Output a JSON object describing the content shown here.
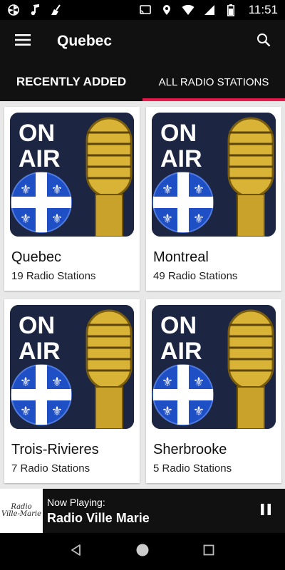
{
  "status_bar": {
    "time": "11:51",
    "left_icons": [
      "pinwheel-icon",
      "music-note-icon",
      "broom-icon"
    ],
    "right_icons": [
      "cast-icon",
      "location-icon",
      "wifi-icon",
      "signal-icon",
      "battery-icon"
    ]
  },
  "app_bar": {
    "title": "Quebec",
    "menu_icon": "hamburger-menu-icon",
    "search_icon": "search-icon"
  },
  "tabs": [
    {
      "label": "RECENTLY ADDED",
      "active": false
    },
    {
      "label": "ALL RADIO STATIONS",
      "active": true
    }
  ],
  "accent_color": "#e6194b",
  "cards": [
    {
      "title": "Quebec",
      "subtitle": "19 Radio Stations",
      "art_text_1": "ON",
      "art_text_2": "AIR"
    },
    {
      "title": "Montreal",
      "subtitle": "49 Radio Stations",
      "art_text_1": "ON",
      "art_text_2": "AIR"
    },
    {
      "title": "Trois-Rivieres",
      "subtitle": "7 Radio Stations",
      "art_text_1": "ON",
      "art_text_2": "AIR"
    },
    {
      "title": "Sherbrooke",
      "subtitle": "5 Radio Stations",
      "art_text_1": "ON",
      "art_text_2": "AIR"
    }
  ],
  "player": {
    "now_playing_label": "Now Playing:",
    "station": "Radio Ville Marie",
    "logo_line_1": "Radio",
    "logo_line_2": "Ville-Marie",
    "control_icon": "pause-icon"
  },
  "nav_bar": {
    "icons": [
      "back-icon",
      "home-icon",
      "recents-icon"
    ]
  }
}
